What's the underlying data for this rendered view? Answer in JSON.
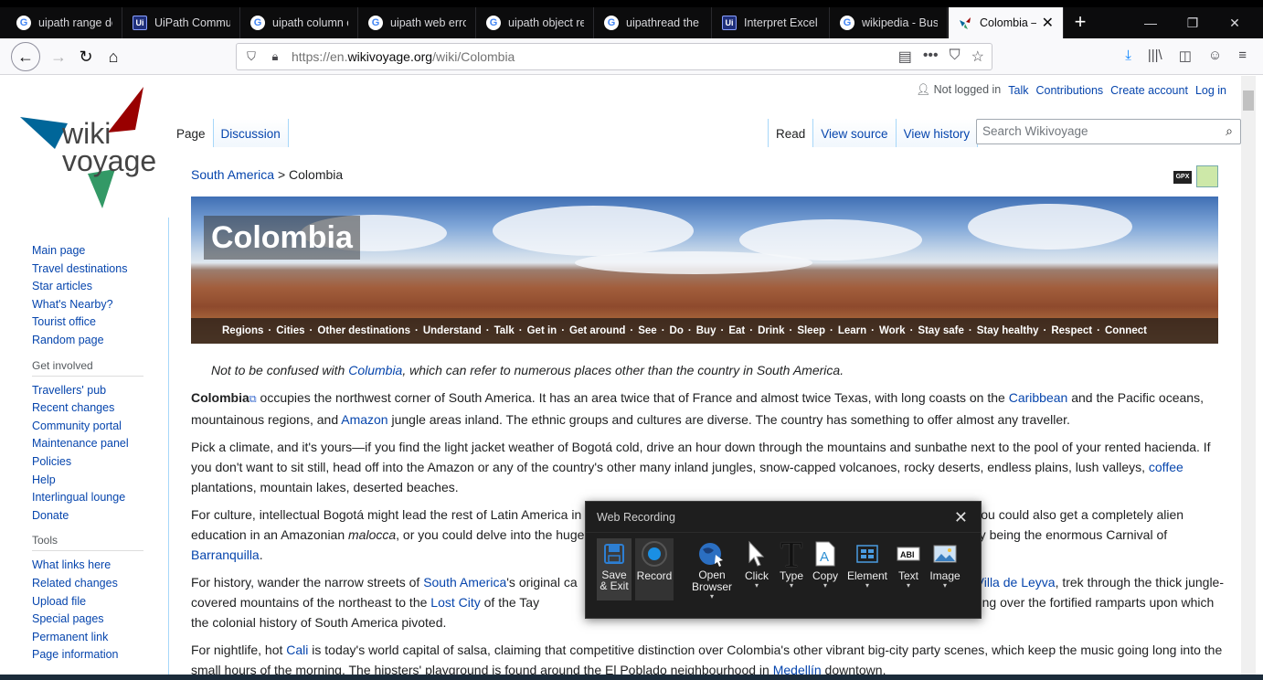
{
  "tabs": [
    {
      "label": "uipath range do",
      "icon": "G",
      "kind": "google"
    },
    {
      "label": "UiPath Commun",
      "icon": "Ui",
      "kind": "uipath"
    },
    {
      "label": "uipath column c",
      "icon": "G",
      "kind": "google"
    },
    {
      "label": "uipath web error",
      "icon": "G",
      "kind": "google"
    },
    {
      "label": "uipath object re",
      "icon": "G",
      "kind": "google"
    },
    {
      "label": "uipathread the r",
      "icon": "G",
      "kind": "google"
    },
    {
      "label": "Interpret Excel R",
      "icon": "Ui",
      "kind": "uipath"
    },
    {
      "label": "wikipedia - Busc",
      "icon": "G",
      "kind": "google"
    },
    {
      "label": "Colombia – T",
      "icon": "W",
      "kind": "wikivoyage",
      "active": true
    }
  ],
  "newtab": "+",
  "window": {
    "min": "—",
    "max": "❐",
    "close": "✕"
  },
  "url": {
    "prefix": "https://en.",
    "domain": "wikivoyage.org",
    "path": "/wiki/Colombia"
  },
  "personal": {
    "not_logged_in": "Not logged in",
    "talk": "Talk",
    "contributions": "Contributions",
    "create_account": "Create account",
    "login": "Log in"
  },
  "logo": {
    "line1": "wiki",
    "line2": "voyage"
  },
  "sidebar": {
    "nav": [
      "Main page",
      "Travel destinations",
      "Star articles",
      "What's Nearby?",
      "Tourist office",
      "Random page"
    ],
    "get_involved_heading": "Get involved",
    "get_involved": [
      "Travellers' pub",
      "Recent changes",
      "Community portal",
      "Maintenance panel",
      "Policies",
      "Help",
      "Interlingual lounge",
      "Donate"
    ],
    "tools_heading": "Tools",
    "tools": [
      "What links here",
      "Related changes",
      "Upload file",
      "Special pages",
      "Permanent link",
      "Page information"
    ]
  },
  "page_tabs": {
    "page": "Page",
    "discussion": "Discussion",
    "read": "Read",
    "view_source": "View source",
    "view_history": "View history"
  },
  "search": {
    "placeholder": "Search Wikivoyage"
  },
  "breadcrumb": {
    "parent": "South America",
    "sep": " > ",
    "current": "Colombia"
  },
  "gpx": "GPX",
  "banner": {
    "title": "Colombia",
    "nav": [
      "Regions",
      "Cities",
      "Other destinations",
      "Understand",
      "Talk",
      "Get in",
      "Get around",
      "See",
      "Do",
      "Buy",
      "Eat",
      "Drink",
      "Sleep",
      "Learn",
      "Work",
      "Stay safe",
      "Stay healthy",
      "Respect",
      "Connect"
    ]
  },
  "article": {
    "hatnote_pre": "Not to be confused with ",
    "hatnote_link": "Columbia",
    "hatnote_post": ", which can refer to numerous places other than the country in South America.",
    "p1_bold": "Colombia",
    "p1_a": " occupies the northwest corner of South America. It has an area twice that of France and almost twice Texas, with long coasts on the ",
    "p1_link1": "Caribbean",
    "p1_b": " and the Pacific oceans, mountainous regions, and ",
    "p1_link2": "Amazon",
    "p1_c": " jungle areas inland. The ethnic groups and cultures are diverse. The country has something to offer almost any traveller.",
    "p2_a": "Pick a climate, and it's yours—if you find the light jacket weather of Bogotá cold, drive an hour down through the mountains and sunbathe next to the pool of your rented hacienda. If you don't want to sit still, head off into the Amazon or any of the country's other many inland jungles, snow-capped volcanoes, rocky deserts, endless plains, lush valleys, ",
    "p2_link": "coffee",
    "p2_b": " plantations, mountain lakes, deserted beaches.",
    "p3_a": "For culture, intellectual Bogotá might lead the rest of Latin America in",
    "p3_b": "you could also get a completely alien education in an Amazonian ",
    "p3_italic": "malocca",
    "p3_c": ", or you could delve into the huge",
    "p3_d": "e display being the enormous Carnival of ",
    "p3_link": "Barranquilla",
    "p3_e": ".",
    "p4_a": "For history, wander the narrow streets of ",
    "p4_link1": "South America",
    "p4_b": "'s original ca",
    "p4_link2": "Villa de Leyva",
    "p4_c": ", trek through the thick jungle-covered mountains of the northeast to the ",
    "p4_link3": "Lost City",
    "p4_d": " of the Tay",
    "p4_e": "city, looking over the fortified ramparts upon which the colonial history of South America pivoted.",
    "p5_a": "For nightlife, hot ",
    "p5_link1": "Cali",
    "p5_b": " is today's world capital of salsa, claiming that competitive distinction over Colombia's other vibrant big-city party scenes, which keep the music going long into the small hours of the morning. The hipsters' playground is found around the El Poblado neighbourhood in ",
    "p5_link2": "Medellín",
    "p5_c": " downtown."
  },
  "recorder": {
    "title": "Web Recording",
    "close": "✕",
    "buttons": [
      {
        "label": "Save & Exit",
        "icon": "save-icon"
      },
      {
        "label": "Record",
        "icon": "record-icon"
      },
      {
        "label": "Open Browser",
        "icon": "globe-icon",
        "dropdown": true
      },
      {
        "label": "Click",
        "icon": "cursor-icon",
        "dropdown": true
      },
      {
        "label": "Type",
        "icon": "type-icon",
        "dropdown": true
      },
      {
        "label": "Copy",
        "icon": "copy-icon",
        "dropdown": true
      },
      {
        "label": "Element",
        "icon": "element-icon",
        "dropdown": true
      },
      {
        "label": "Text",
        "icon": "text-icon",
        "dropdown": true
      },
      {
        "label": "Image",
        "icon": "image-icon",
        "dropdown": true
      }
    ]
  }
}
